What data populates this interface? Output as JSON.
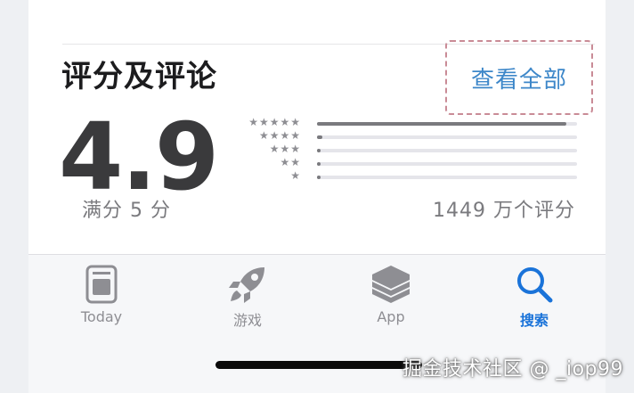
{
  "ratings": {
    "title": "评分及评论",
    "see_all": "查看全部",
    "score": "4.9",
    "out_of": "满分 5 分",
    "count": "1449 万个评分",
    "distribution": [
      {
        "stars": "★★★★★",
        "fraction": 0.96
      },
      {
        "stars": "★★★★",
        "fraction": 0.02
      },
      {
        "stars": "★★★",
        "fraction": 0.005
      },
      {
        "stars": "★★",
        "fraction": 0.003
      },
      {
        "stars": "★",
        "fraction": 0.008
      }
    ]
  },
  "tabbar": {
    "tabs": [
      {
        "label": "Today",
        "icon": "today-icon"
      },
      {
        "label": "游戏",
        "icon": "rocket-icon"
      },
      {
        "label": "App",
        "icon": "layers-icon"
      },
      {
        "label": "搜索",
        "icon": "search-icon",
        "active": true
      }
    ],
    "active_color": "#1a73d9",
    "inactive_color": "#8e8e93"
  },
  "watermark": "掘金技术社区 @ _iop99"
}
